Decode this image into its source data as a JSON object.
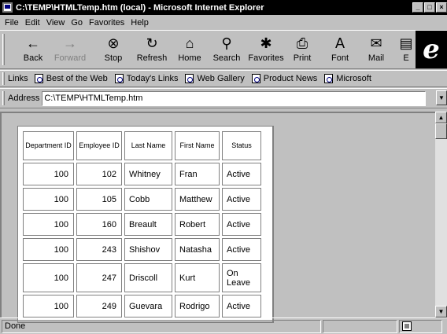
{
  "window": {
    "title": "C:\\TEMP\\HTMLTemp.htm (local) - Microsoft Internet Explorer",
    "minimize": "_",
    "maximize": "□",
    "close": "×"
  },
  "menu": {
    "file": "File",
    "edit": "Edit",
    "view": "View",
    "go": "Go",
    "favorites": "Favorites",
    "help": "Help"
  },
  "toolbar": {
    "back": "Back",
    "forward": "Forward",
    "stop": "Stop",
    "refresh": "Refresh",
    "home": "Home",
    "search": "Search",
    "favorites": "Favorites",
    "print": "Print",
    "font": "Font",
    "mail": "Mail",
    "edit_truncated": "E"
  },
  "icons": {
    "back": "←",
    "forward": "→",
    "stop": "⊗",
    "refresh": "↻",
    "home": "⌂",
    "search": "⚲",
    "favorites": "✱",
    "print": "⎙",
    "font": "A",
    "mail": "✉",
    "edit": "▤",
    "ie_logo": "e"
  },
  "links": {
    "label": "Links",
    "items": [
      "Best of the Web",
      "Today's Links",
      "Web Gallery",
      "Product News",
      "Microsoft"
    ]
  },
  "address": {
    "label": "Address",
    "value": "C:\\TEMP\\HTMLTemp.htm"
  },
  "table": {
    "headers": [
      "Department ID",
      "Employee ID",
      "Last Name",
      "First Name",
      "Status"
    ],
    "rows": [
      [
        "100",
        "102",
        "Whitney",
        "Fran",
        "Active"
      ],
      [
        "100",
        "105",
        "Cobb",
        "Matthew",
        "Active"
      ],
      [
        "100",
        "160",
        "Breault",
        "Robert",
        "Active"
      ],
      [
        "100",
        "243",
        "Shishov",
        "Natasha",
        "Active"
      ],
      [
        "100",
        "247",
        "Driscoll",
        "Kurt",
        "On Leave"
      ],
      [
        "100",
        "249",
        "Guevara",
        "Rodrigo",
        "Active"
      ]
    ]
  },
  "status": {
    "text": "Done"
  }
}
